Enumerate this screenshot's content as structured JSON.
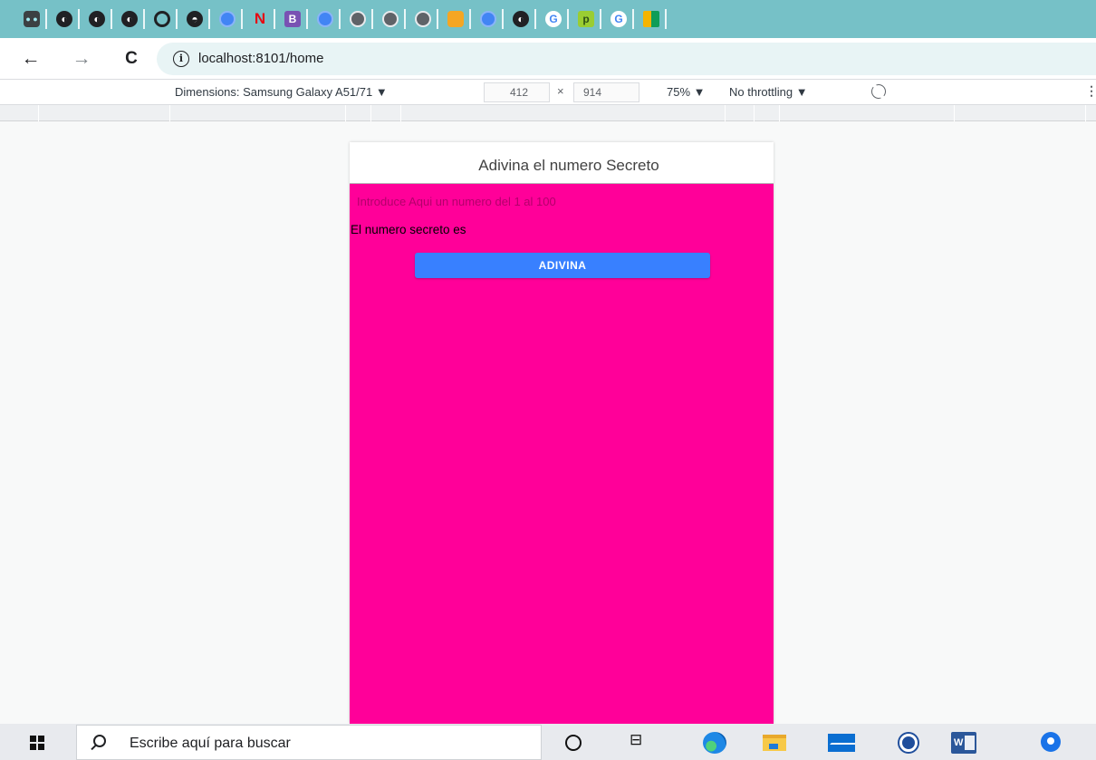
{
  "bookmarks": {
    "icons": [
      "site-logo-icon",
      "globe-icon",
      "globe-icon",
      "globe-icon",
      "instagram-icon",
      "github-icon",
      "chrome-site-icon",
      "netflix-icon",
      "bootstrap-icon",
      "chrome-site-icon",
      "chromium-icon",
      "chromium-icon",
      "chromium-icon",
      "shield-icon",
      "chrome-site-icon",
      "globe-icon",
      "google-icon",
      "p-icon",
      "google-icon",
      "photos-app-icon"
    ],
    "letters": {
      "netflix": "N",
      "bootstrap": "B",
      "google": "G",
      "p": "p"
    }
  },
  "browser": {
    "back_glyph": "←",
    "forward_glyph": "→",
    "reload_glyph": "C",
    "info_glyph": "i",
    "url": "localhost:8101/home"
  },
  "devtools": {
    "dimensions_label": "Dimensions: Samsung Galaxy A51/71 ▼",
    "width": "412",
    "times": "×",
    "height": "914",
    "zoom": "75% ▼",
    "throttling": "No throttling ▼",
    "more_glyph": "⋮"
  },
  "app": {
    "header_title": "Adivina el numero Secreto",
    "input_placeholder": "Introduce Aqui un numero del 1 al 100",
    "secret_label": "El numero secreto es",
    "guess_button": "ADIVINA",
    "colors": {
      "content_bg": "#ff0099",
      "button_bg": "#3880ff"
    }
  },
  "taskbar": {
    "search_text": "Escribe aquí para buscar",
    "taskview_glyph": "⊟",
    "word_letter": "W"
  }
}
